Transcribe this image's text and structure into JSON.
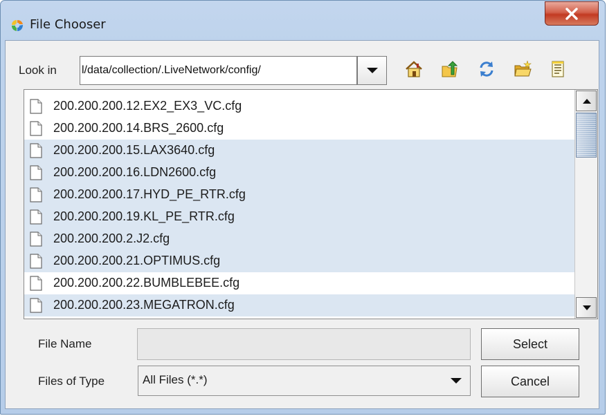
{
  "window": {
    "title": "File Chooser"
  },
  "lookin": {
    "label": "Look in",
    "path": "l/data/collection/.LiveNetwork/config/"
  },
  "toolbar": {
    "icons": [
      "home-icon",
      "up-folder-icon",
      "refresh-icon",
      "new-folder-icon",
      "details-view-icon"
    ]
  },
  "files": [
    {
      "name": "200.200.200.12.EX2_EX3_VC.cfg",
      "selected": false
    },
    {
      "name": "200.200.200.14.BRS_2600.cfg",
      "selected": false
    },
    {
      "name": "200.200.200.15.LAX3640.cfg",
      "selected": true
    },
    {
      "name": "200.200.200.16.LDN2600.cfg",
      "selected": true
    },
    {
      "name": "200.200.200.17.HYD_PE_RTR.cfg",
      "selected": true
    },
    {
      "name": "200.200.200.19.KL_PE_RTR.cfg",
      "selected": true
    },
    {
      "name": "200.200.200.2.J2.cfg",
      "selected": true
    },
    {
      "name": "200.200.200.21.OPTIMUS.cfg",
      "selected": true
    },
    {
      "name": "200.200.200.22.BUMBLEBEE.cfg",
      "selected": false
    },
    {
      "name": "200.200.200.23.MEGATRON.cfg",
      "selected": true
    }
  ],
  "form": {
    "file_name_label": "File Name",
    "file_name_value": "",
    "files_of_type_label": "Files of Type",
    "files_of_type_value": "All Files (*.*)"
  },
  "buttons": {
    "select": "Select",
    "cancel": "Cancel"
  },
  "colors": {
    "selection": "#dbe6f2",
    "close_button": "#c23a22",
    "frame": "#bed3ec"
  }
}
